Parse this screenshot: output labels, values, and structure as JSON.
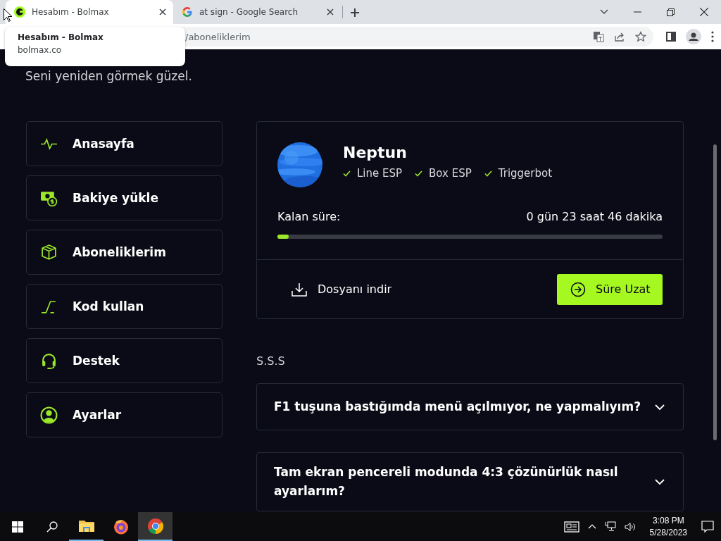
{
  "browser": {
    "tabs": [
      {
        "title": "Hesabım - Bolmax",
        "kind": "site",
        "selected": true
      },
      {
        "title": "at sign - Google Search",
        "kind": "google",
        "selected": false
      }
    ],
    "address": "/aboneliklerim",
    "tooltip": {
      "title": "Hesabım - Bolmax",
      "domain": "bolmax.co"
    }
  },
  "page": {
    "greeting": "Seni yeniden görmek güzel.",
    "sidebar": {
      "items": [
        {
          "label": "Anasayfa",
          "kind": "pulse"
        },
        {
          "label": "Bakiye yükle",
          "kind": "money"
        },
        {
          "label": "Aboneliklerim",
          "kind": "box"
        },
        {
          "label": "Kod kullan",
          "kind": "code"
        },
        {
          "label": "Destek",
          "kind": "headset"
        },
        {
          "label": "Ayarlar",
          "kind": "user"
        }
      ]
    },
    "subscription": {
      "name": "Neptun",
      "features": [
        "Line ESP",
        "Box ESP",
        "Triggerbot"
      ],
      "remaining_label": "Kalan süre:",
      "remaining_value": "0 gün 23 saat 46 dakika",
      "level": 0.03,
      "download": "Dosyanı indir",
      "extend": "Süre Uzat"
    },
    "faq": {
      "title": "S.S.S",
      "items": [
        {
          "question": "F1 tuşuna bastığımda menü açılmıyor, ne yapmalıyım?",
          "expanded": false
        },
        {
          "question": "Tam ekran pencereli modunda 4:3 çözünürlük nasıl ayarlarım?",
          "expanded": false
        }
      ]
    }
  },
  "taskbar": {
    "apps": [
      {
        "kind": "explorer",
        "selected": false
      },
      {
        "kind": "firefox",
        "selected": false
      },
      {
        "kind": "chrome",
        "selected": true
      }
    ],
    "time": "3:08 PM",
    "date": "5/28/2023"
  }
}
